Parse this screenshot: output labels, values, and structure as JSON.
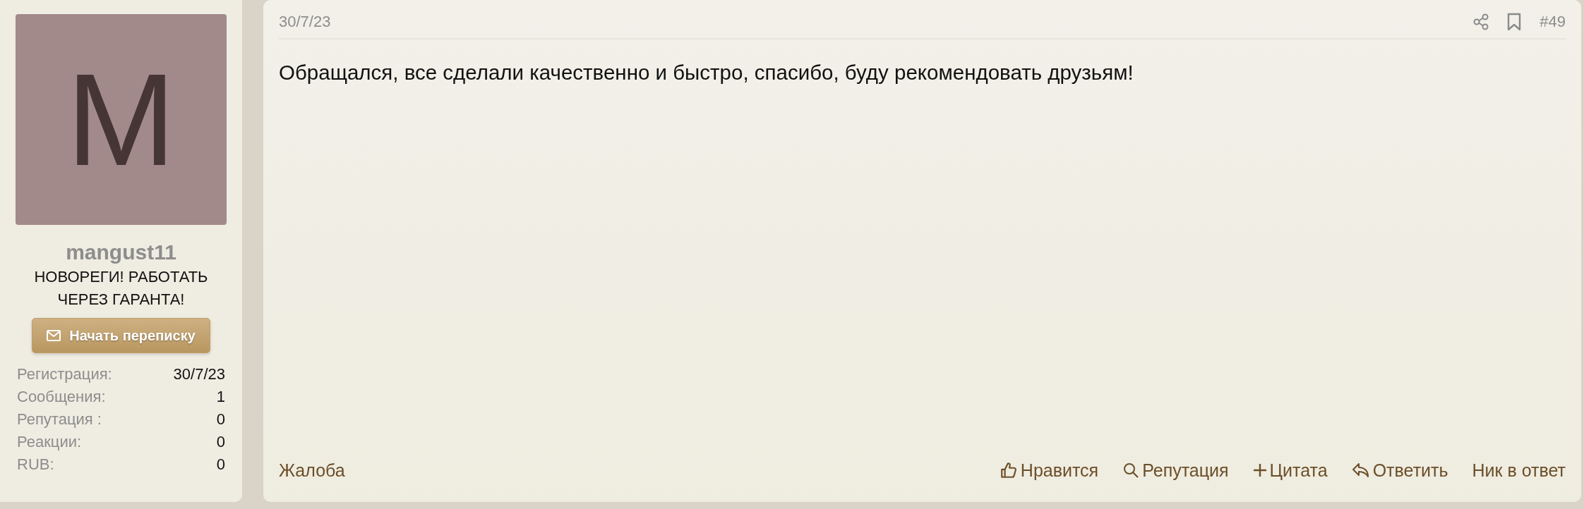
{
  "user": {
    "avatar_letter": "M",
    "name": "mangust11",
    "user_title": "НОВОРЕГИ! РАБОТАТЬ ЧЕРЕЗ ГАРАНТА!",
    "message_button": "Начать переписку",
    "stats": [
      {
        "label": "Регистрация:",
        "value": "30/7/23"
      },
      {
        "label": "Сообщения:",
        "value": "1"
      },
      {
        "label": "Репутация :",
        "value": "0"
      },
      {
        "label": "Реакции:",
        "value": "0"
      },
      {
        "label": "RUB:",
        "value": "0"
      }
    ]
  },
  "post": {
    "date": "30/7/23",
    "number": "#49",
    "text": "Обращался, все сделали качественно и быстро, спасибо, буду рекомендовать друзьям!",
    "report": "Жалоба",
    "actions": [
      {
        "kind": "like",
        "label": "Нравится"
      },
      {
        "kind": "search",
        "label": "Репутация"
      },
      {
        "kind": "plus",
        "label": "Цитата"
      },
      {
        "kind": "reply",
        "label": "Ответить"
      },
      {
        "kind": "none",
        "label": "Ник в ответ"
      }
    ]
  }
}
